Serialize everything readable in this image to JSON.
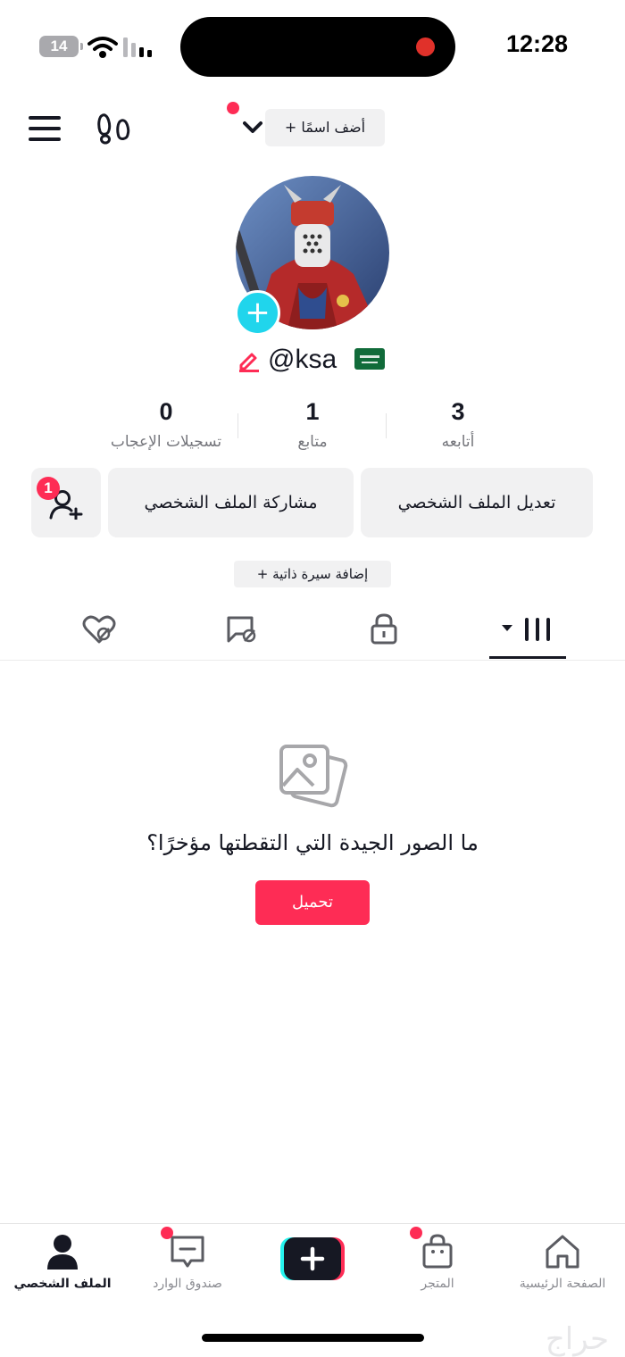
{
  "status_bar": {
    "battery": "14",
    "time": "12:28"
  },
  "header": {
    "add_name_label": "+ أضف اسمًا",
    "menu_icon": "hamburger-menu-icon",
    "footprints_icon": "footprints-icon",
    "dropdown_icon": "chevron-down-icon"
  },
  "profile": {
    "username": "@ksa",
    "flag_icon": "saudi-flag-icon",
    "edit_icon": "pencil-icon"
  },
  "stats": {
    "following_count": "3",
    "following_label": "أتابعه",
    "followers_count": "1",
    "followers_label": "متابع",
    "likes_count": "0",
    "likes_label": "تسجيلات الإعجاب"
  },
  "actions": {
    "edit_profile": "تعديل الملف الشخصي",
    "share_profile": "مشاركة الملف الشخصي",
    "add_friends_badge": "1"
  },
  "bio": {
    "add_bio_label": "+ إضافة سيرة ذاتية"
  },
  "tabs": [
    {
      "icon": "grid-icon",
      "active": true
    },
    {
      "icon": "lock-icon",
      "active": false
    },
    {
      "icon": "hidden-tag-icon",
      "active": false
    },
    {
      "icon": "hidden-heart-icon",
      "active": false
    }
  ],
  "empty_state": {
    "icon": "photos-icon",
    "message": "ما الصور الجيدة التي التقطتها مؤخرًا؟",
    "upload_label": "تحميل"
  },
  "bottom_nav": {
    "home": "الصفحة الرئيسية",
    "shop": "المتجر",
    "inbox": "صندوق الوارد",
    "profile": "الملف الشخصي"
  },
  "watermark": "حراج",
  "colors": {
    "accent": "#fe2c55",
    "avatar_plus": "#20d5ec",
    "text": "#161823",
    "muted": "#75767c",
    "button_bg": "#f1f1f2"
  }
}
